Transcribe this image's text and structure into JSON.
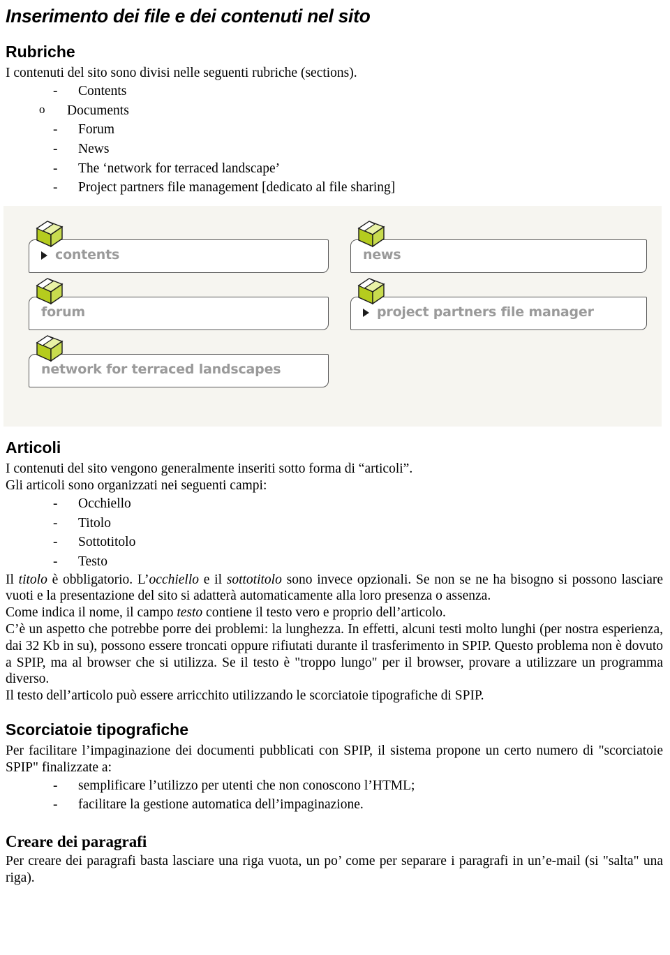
{
  "document": {
    "title": "Inserimento dei file e dei contenuti nel sito"
  },
  "sections": {
    "rubriche": {
      "heading": "Rubriche",
      "intro": "I contenuti del sito sono divisi nelle seguenti rubriche (sections).",
      "items": [
        {
          "bullet": "-",
          "label": "Contents"
        },
        {
          "bullet": "o",
          "label": "Documents",
          "level": 2
        },
        {
          "bullet": "-",
          "label": "Forum"
        },
        {
          "bullet": "-",
          "label": "News"
        },
        {
          "bullet": "-",
          "label": "The ‘network for terraced landscape’"
        },
        {
          "bullet": "-",
          "label": "Project partners file management [dedicato al file sharing]"
        }
      ]
    },
    "screenshot": {
      "background_color": "#f6f5f0",
      "box_border_color": "#575757",
      "label_color": "#9a9a9a",
      "cube_colors": {
        "front": "#b5cc1e",
        "side": "#c8db4e",
        "top": "#e9f2a6",
        "outline": "#1b1b1b"
      },
      "left_column": [
        {
          "label": "contents",
          "has_arrow": true,
          "icon": "green-cube-icon"
        },
        {
          "label": "forum",
          "has_arrow": false,
          "icon": "green-cube-icon"
        },
        {
          "label": "network for terraced landscapes",
          "has_arrow": false,
          "icon": "green-cube-icon"
        }
      ],
      "right_column": [
        {
          "label": "news",
          "has_arrow": false,
          "icon": "green-cube-icon"
        },
        {
          "label": "project partners file manager",
          "has_arrow": true,
          "icon": "green-cube-icon"
        }
      ]
    },
    "articoli": {
      "heading": "Articoli",
      "p1": "I contenuti del sito vengono generalmente inseriti sotto forma di “articoli”.",
      "p2": "Gli articoli sono organizzati nei seguenti campi:",
      "fields": [
        {
          "bullet": "-",
          "label": "Occhiello"
        },
        {
          "bullet": "-",
          "label": "Titolo"
        },
        {
          "bullet": "-",
          "label": "Sottotitolo"
        },
        {
          "bullet": "-",
          "label": "Testo"
        }
      ],
      "p3_a": "Il ",
      "p3_i1": "titolo",
      "p3_b": " è obbligatorio. L’",
      "p3_i2": "occhiello",
      "p3_c": " e il ",
      "p3_i3": "sottotitolo",
      "p3_d": " sono invece opzionali. Se non se ne ha bisogno si possono lasciare vuoti e la presentazione del sito si adatterà automaticamente alla loro presenza o assenza.",
      "p4_a": "Come indica il nome, il campo ",
      "p4_i": "testo",
      "p4_b": " contiene il testo vero e proprio dell’articolo.",
      "p5": "C’è un aspetto che potrebbe porre dei problemi: la lunghezza. In effetti, alcuni testi molto lunghi (per nostra esperienza, dai 32 Kb in su), possono essere troncati oppure rifiutati durante il trasferimento in SPIP. Questo problema non è dovuto a SPIP, ma al browser che si utilizza. Se il testo è \"troppo lungo\" per il browser, provare a utilizzare un programma diverso.",
      "p6": "Il testo dell’articolo può essere arricchito utilizzando le scorciatoie tipografiche di SPIP."
    },
    "scorciatoie": {
      "heading": "Scorciatoie tipografiche",
      "p1": "Per facilitare l’impaginazione dei documenti pubblicati con SPIP, il sistema propone un certo numero di \"scorciatoie SPIP\" finalizzate a:",
      "items": [
        {
          "bullet": "-",
          "label": "semplificare l’utilizzo per utenti che non conoscono l’HTML;"
        },
        {
          "bullet": "-",
          "label": "facilitare la gestione automatica dell’impaginazione."
        }
      ]
    },
    "paragrafi": {
      "heading": "Creare dei paragrafi",
      "p1": "Per creare dei paragrafi basta lasciare una riga vuota, un po’ come per separare i paragrafi in un’e-mail (si \"salta\" una riga)."
    }
  }
}
